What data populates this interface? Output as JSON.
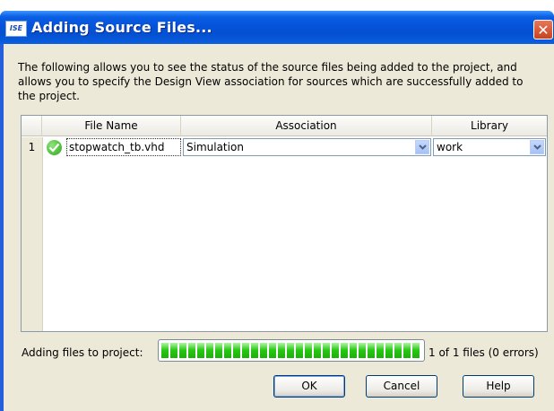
{
  "window": {
    "icon_text": "ISE",
    "title": "Adding Source Files...",
    "close_glyph": "✕"
  },
  "description": "The following allows you to see the status of the source files being added to the project, and allows you to specify the Design View association for sources which are successfully added to the project.",
  "table": {
    "columns": [
      "File Name",
      "Association",
      "Library"
    ],
    "rows": [
      {
        "number": "1",
        "status_icon": "check-icon",
        "file_name": "stopwatch_tb.vhd",
        "association": "Simulation",
        "library": "work"
      }
    ]
  },
  "progress": {
    "label": "Adding files to project:",
    "value": 1.0,
    "status": "1 of 1 files (0 errors)"
  },
  "buttons": {
    "ok": "OK",
    "cancel": "Cancel",
    "help": "Help"
  },
  "colors": {
    "titlebar": "#0553db",
    "progress_fill": "#27c514",
    "dialog_bg": "#ece9d8"
  }
}
